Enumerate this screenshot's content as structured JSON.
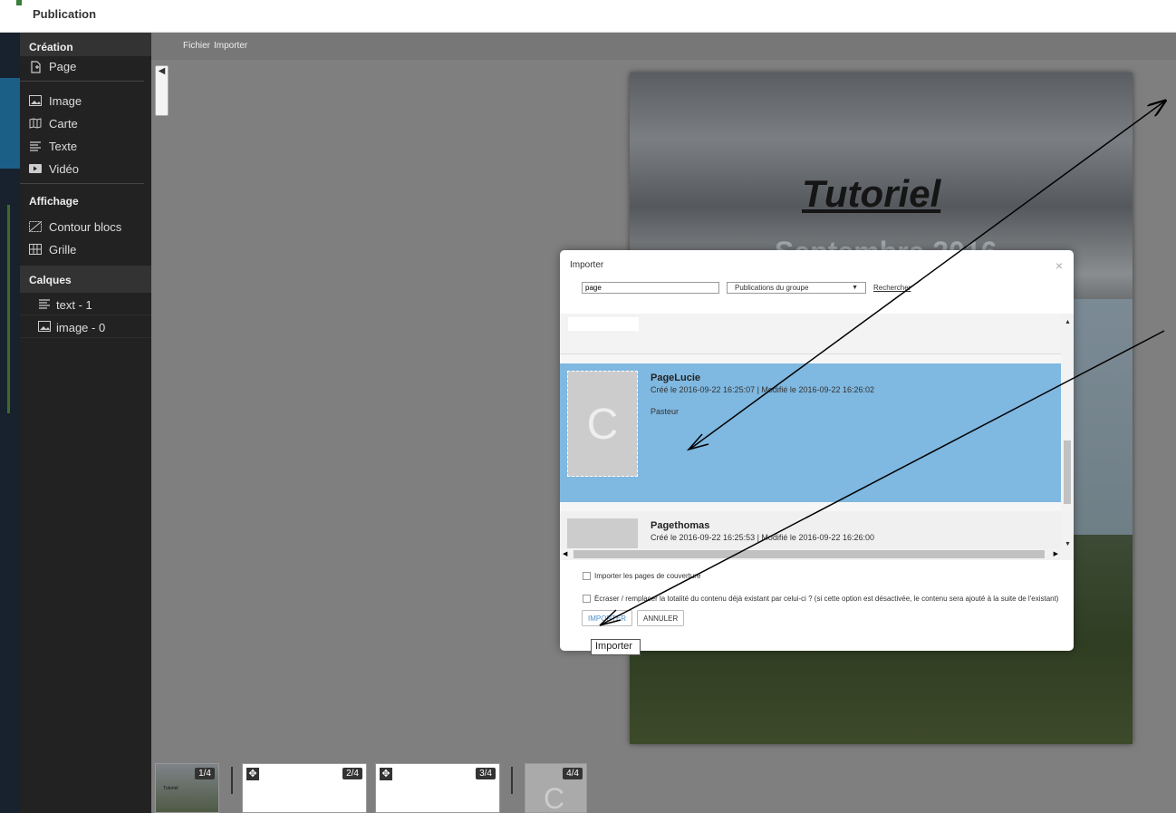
{
  "app": {
    "title": "Publication"
  },
  "sidebar": {
    "creation_header": "Création",
    "creation_items": [
      {
        "label": "Page",
        "icon": "page-add-icon"
      },
      {
        "label": "Image",
        "icon": "image-icon"
      },
      {
        "label": "Carte",
        "icon": "map-icon"
      },
      {
        "label": "Texte",
        "icon": "text-icon"
      },
      {
        "label": "Vidéo",
        "icon": "video-icon"
      }
    ],
    "display_header": "Affichage",
    "display_items": [
      {
        "label": "Contour blocs",
        "icon": "outline-icon"
      },
      {
        "label": "Grille",
        "icon": "grid-icon"
      }
    ],
    "layers_header": "Calques",
    "layers": [
      {
        "label": "text - 1",
        "icon": "text-icon"
      },
      {
        "label": "image - 0",
        "icon": "image-icon"
      }
    ]
  },
  "menubar": {
    "file": "Fichier",
    "import": "Importer"
  },
  "preview": {
    "title": "Tutoriel",
    "subtitle": "Septembre 2016"
  },
  "thumbnails": [
    {
      "label": "1/4",
      "text": "Tutoriel"
    },
    {
      "label": "2/4"
    },
    {
      "label": "3/4"
    },
    {
      "label": "4/4",
      "letter": "C"
    }
  ],
  "dialog": {
    "title": "Importer",
    "close": "×",
    "search_value": "page",
    "source_selected": "Publications du groupe",
    "search_link": "Rechercher",
    "results": [
      {
        "name": "PageLucie",
        "dates": "Créé le 2016-09-22 16:25:07 | Modifié le 2016-09-22 16:26:02",
        "description": "Pasteur",
        "thumb_letter": "C",
        "selected": true
      },
      {
        "name": "Pagethomas",
        "dates": "Créé le 2016-09-22 16:25:53 | Modifié le 2016-09-22 16:26:00",
        "selected": false
      }
    ],
    "option_cover": "Importer les pages de couverture",
    "option_overwrite": "Écraser / remplacer la totalité du contenu déjà existant par celui-ci ? (si cette option est désactivée, le contenu sera ajouté à la suite de l'existant)",
    "import_button": "IMPORTER",
    "cancel_button": "ANNULER"
  },
  "tooltip": "Importer",
  "colors": {
    "accent": "#7fb8e0",
    "sidebar_bg": "#222222",
    "workspace_bg": "#7f7f7f"
  }
}
